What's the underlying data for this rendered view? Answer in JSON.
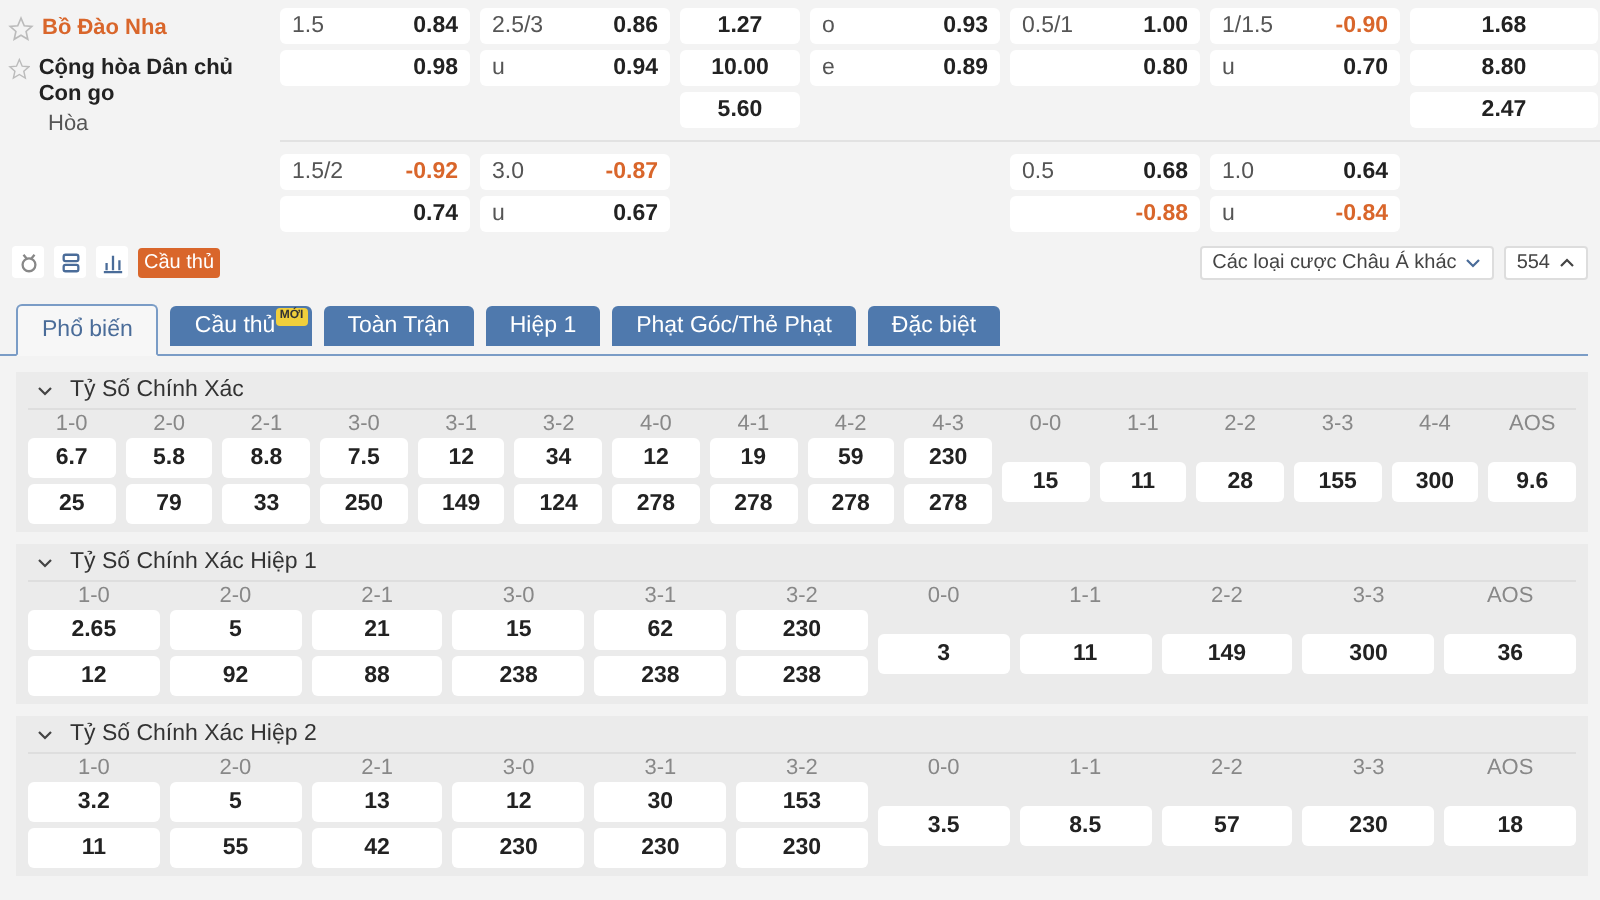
{
  "teams": [
    {
      "kind": "team",
      "name": "Bồ Đào Nha",
      "highlighted": true
    },
    {
      "kind": "team",
      "name": "Cộng hòa Dân chủ Con go",
      "highlighted": false
    },
    {
      "kind": "draw",
      "name": "Hòa",
      "highlighted": false
    }
  ],
  "odds_blocks": [
    {
      "rows": [
        {
          "cells": [
            {
              "kind": "pair",
              "label": "1.5",
              "value": "0.84",
              "negative": false
            },
            {
              "kind": "pair",
              "label": "2.5/3",
              "value": "0.86",
              "negative": false
            },
            {
              "kind": "single",
              "value": "1.27",
              "negative": false
            },
            {
              "kind": "pair",
              "label": "o",
              "value": "0.93",
              "negative": false
            },
            {
              "kind": "pair",
              "label": "0.5/1",
              "value": "1.00",
              "negative": false
            },
            {
              "kind": "pair",
              "label": "1/1.5",
              "value": "-0.90",
              "negative": true
            },
            {
              "kind": "single",
              "value": "1.68",
              "negative": false
            }
          ]
        },
        {
          "cells": [
            {
              "kind": "pair",
              "value": "0.98",
              "negative": false
            },
            {
              "kind": "pair",
              "label": "u",
              "value": "0.94",
              "negative": false
            },
            {
              "kind": "single",
              "value": "10.00",
              "negative": false
            },
            {
              "kind": "pair",
              "label": "e",
              "value": "0.89",
              "negative": false
            },
            {
              "kind": "pair",
              "value": "0.80",
              "negative": false
            },
            {
              "kind": "pair",
              "label": "u",
              "value": "0.70",
              "negative": false
            },
            {
              "kind": "single",
              "value": "8.80",
              "negative": false
            }
          ]
        },
        {
          "cells": [
            {
              "kind": "empty"
            },
            {
              "kind": "empty"
            },
            {
              "kind": "single",
              "value": "5.60",
              "negative": false
            },
            {
              "kind": "empty"
            },
            {
              "kind": "empty"
            },
            {
              "kind": "empty"
            },
            {
              "kind": "single",
              "value": "2.47",
              "negative": false
            }
          ]
        }
      ]
    },
    {
      "rows": [
        {
          "cells": [
            {
              "kind": "pair",
              "label": "1.5/2",
              "value": "-0.92",
              "negative": true
            },
            {
              "kind": "pair",
              "label": "3.0",
              "value": "-0.87",
              "negative": true
            },
            {
              "kind": "empty"
            },
            {
              "kind": "empty"
            },
            {
              "kind": "pair",
              "label": "0.5",
              "value": "0.68",
              "negative": false
            },
            {
              "kind": "pair",
              "label": "1.0",
              "value": "0.64",
              "negative": false
            },
            {
              "kind": "empty"
            }
          ]
        },
        {
          "cells": [
            {
              "kind": "pair",
              "value": "0.74",
              "negative": false
            },
            {
              "kind": "pair",
              "label": "u",
              "value": "0.67",
              "negative": false
            },
            {
              "kind": "empty"
            },
            {
              "kind": "empty"
            },
            {
              "kind": "pair",
              "value": "-0.88",
              "negative": true
            },
            {
              "kind": "pair",
              "label": "u",
              "value": "-0.84",
              "negative": true
            },
            {
              "kind": "empty"
            }
          ]
        }
      ]
    }
  ],
  "toolbar": {
    "player_button": "Cầu thủ",
    "market_dropdown": "Các loại cược Châu Á khác",
    "count_button": "554"
  },
  "tabs": [
    {
      "label": "Phổ biến",
      "selected": true
    },
    {
      "label": "Cầu thủ",
      "selected": false,
      "badge": "MỚI"
    },
    {
      "label": "Toàn Trận",
      "selected": false
    },
    {
      "label": "Hiệp 1",
      "selected": false
    },
    {
      "label": "Phạt Góc/Thẻ Phạt",
      "selected": false
    },
    {
      "label": "Đặc biệt",
      "selected": false
    }
  ],
  "sections": [
    {
      "title": "Tỷ Số Chính Xác",
      "expanded": true,
      "columns": [
        {
          "header": "1-0",
          "values": [
            "6.7",
            "25"
          ]
        },
        {
          "header": "2-0",
          "values": [
            "5.8",
            "79"
          ]
        },
        {
          "header": "2-1",
          "values": [
            "8.8",
            "33"
          ]
        },
        {
          "header": "3-0",
          "values": [
            "7.5",
            "250"
          ]
        },
        {
          "header": "3-1",
          "values": [
            "12",
            "149"
          ]
        },
        {
          "header": "3-2",
          "values": [
            "34",
            "124"
          ]
        },
        {
          "header": "4-0",
          "values": [
            "12",
            "278"
          ]
        },
        {
          "header": "4-1",
          "values": [
            "19",
            "278"
          ]
        },
        {
          "header": "4-2",
          "values": [
            "59",
            "278"
          ]
        },
        {
          "header": "4-3",
          "values": [
            "230",
            "278"
          ]
        },
        {
          "header": "0-0",
          "values": [
            "15"
          ]
        },
        {
          "header": "1-1",
          "values": [
            "11"
          ]
        },
        {
          "header": "2-2",
          "values": [
            "28"
          ]
        },
        {
          "header": "3-3",
          "values": [
            "155"
          ]
        },
        {
          "header": "4-4",
          "values": [
            "300"
          ]
        },
        {
          "header": "AOS",
          "values": [
            "9.6"
          ]
        }
      ]
    },
    {
      "title": "Tỷ Số Chính Xác Hiệp 1",
      "expanded": true,
      "columns": [
        {
          "header": "1-0",
          "values": [
            "2.65",
            "12"
          ]
        },
        {
          "header": "2-0",
          "values": [
            "5",
            "92"
          ]
        },
        {
          "header": "2-1",
          "values": [
            "21",
            "88"
          ]
        },
        {
          "header": "3-0",
          "values": [
            "15",
            "238"
          ]
        },
        {
          "header": "3-1",
          "values": [
            "62",
            "238"
          ]
        },
        {
          "header": "3-2",
          "values": [
            "230",
            "238"
          ]
        },
        {
          "header": "0-0",
          "values": [
            "3"
          ]
        },
        {
          "header": "1-1",
          "values": [
            "11"
          ]
        },
        {
          "header": "2-2",
          "values": [
            "149"
          ]
        },
        {
          "header": "3-3",
          "values": [
            "300"
          ]
        },
        {
          "header": "AOS",
          "values": [
            "36"
          ]
        }
      ]
    },
    {
      "title": "Tỷ Số Chính Xác Hiệp 2",
      "expanded": true,
      "columns": [
        {
          "header": "1-0",
          "values": [
            "3.2",
            "11"
          ]
        },
        {
          "header": "2-0",
          "values": [
            "5",
            "55"
          ]
        },
        {
          "header": "2-1",
          "values": [
            "13",
            "42"
          ]
        },
        {
          "header": "3-0",
          "values": [
            "12",
            "230"
          ]
        },
        {
          "header": "3-1",
          "values": [
            "30",
            "230"
          ]
        },
        {
          "header": "3-2",
          "values": [
            "153",
            "230"
          ]
        },
        {
          "header": "0-0",
          "values": [
            "3.5"
          ]
        },
        {
          "header": "1-1",
          "values": [
            "8.5"
          ]
        },
        {
          "header": "2-2",
          "values": [
            "57"
          ]
        },
        {
          "header": "3-3",
          "values": [
            "230"
          ]
        },
        {
          "header": "AOS",
          "values": [
            "18"
          ]
        }
      ]
    }
  ]
}
